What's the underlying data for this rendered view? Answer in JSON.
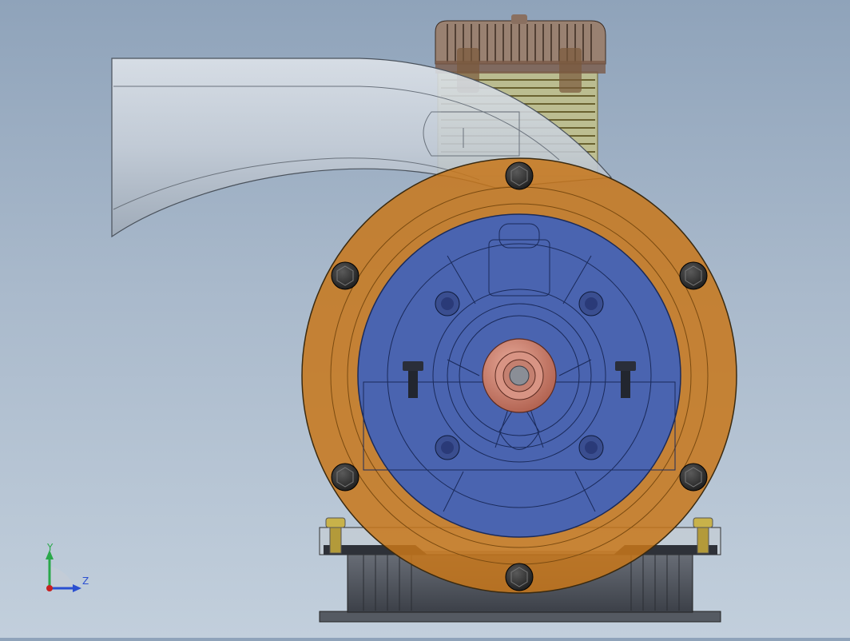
{
  "view": {
    "background_top": "#8fa3ba",
    "background_bottom": "#c2cfdc"
  },
  "model": {
    "flange_color": "#c8771a",
    "housing_color": "#4a64b0",
    "hub_color": "#c97a66",
    "intake_color": "#cfd6de",
    "cylinder_fin_color": "#d8cc6a",
    "head_color": "#8a6a5a",
    "bolt_icon": "hex-bolt-icon"
  },
  "triad": {
    "y_label": "Y",
    "z_label": "Z",
    "y_color": "#2aa84a",
    "z_color": "#2a4fd0",
    "x_color": "#c82020"
  }
}
